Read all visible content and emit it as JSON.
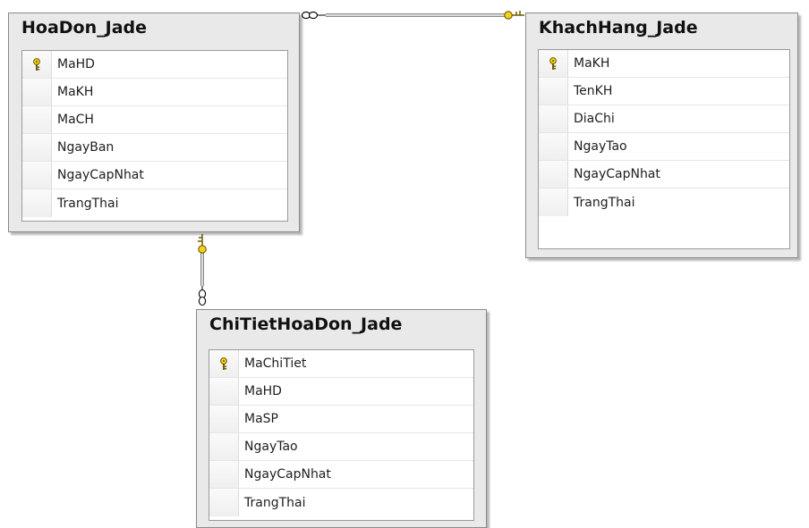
{
  "tables": [
    {
      "title": "HoaDon_Jade",
      "columns": [
        {
          "name": "MaHD",
          "primary_key": true
        },
        {
          "name": "MaKH",
          "primary_key": false
        },
        {
          "name": "MaCH",
          "primary_key": false
        },
        {
          "name": "NgayBan",
          "primary_key": false
        },
        {
          "name": "NgayCapNhat",
          "primary_key": false
        },
        {
          "name": "TrangThai",
          "primary_key": false
        }
      ]
    },
    {
      "title": "KhachHang_Jade",
      "columns": [
        {
          "name": "MaKH",
          "primary_key": true
        },
        {
          "name": "TenKH",
          "primary_key": false
        },
        {
          "name": "DiaChi",
          "primary_key": false
        },
        {
          "name": "NgayTao",
          "primary_key": false
        },
        {
          "name": "NgayCapNhat",
          "primary_key": false
        },
        {
          "name": "TrangThai",
          "primary_key": false
        }
      ]
    },
    {
      "title": "ChiTietHoaDon_Jade",
      "columns": [
        {
          "name": "MaChiTiet",
          "primary_key": true
        },
        {
          "name": "MaHD",
          "primary_key": false
        },
        {
          "name": "MaSP",
          "primary_key": false
        },
        {
          "name": "NgayTao",
          "primary_key": false
        },
        {
          "name": "NgayCapNhat",
          "primary_key": false
        },
        {
          "name": "TrangThai",
          "primary_key": false
        }
      ]
    }
  ],
  "relationships": [
    {
      "one_side": "KhachHang_Jade",
      "many_side": "HoaDon_Jade"
    },
    {
      "one_side": "HoaDon_Jade",
      "many_side": "ChiTietHoaDon_Jade"
    }
  ],
  "colors": {
    "key": "#f2d21b",
    "key_outline": "#6e5a00",
    "line": "#8a8a8a"
  }
}
